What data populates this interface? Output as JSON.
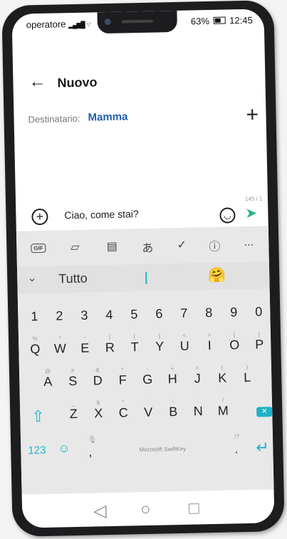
{
  "status": {
    "carrier": "operatore",
    "signal_icon": "signal-icon",
    "battery_percent": "63%",
    "time": "12:45"
  },
  "header": {
    "back_icon": "back-arrow-icon",
    "title": "Nuovo"
  },
  "recipient": {
    "label": "Destinatario:",
    "name": "Mamma",
    "add_icon": "plus-icon"
  },
  "compose": {
    "attach_icon": "plus-circle-icon",
    "message": "Ciao, come stai?",
    "emoji_icon": "smiley-icon",
    "counter": "145 / 1",
    "send_icon": "send-icon"
  },
  "keyboard": {
    "toolbar": {
      "gif": "GIF",
      "items": [
        "sticker-icon",
        "clipboard-icon",
        "translate-icon",
        "check-icon",
        "info-icon",
        "more-icon"
      ],
      "more": "..."
    },
    "suggestion": {
      "word": "Tutto",
      "emoji": "🤗"
    },
    "num_row": [
      {
        "pri": "1",
        "sec": ""
      },
      {
        "pri": "2",
        "sec": ""
      },
      {
        "pri": "3",
        "sec": ""
      },
      {
        "pri": "4",
        "sec": ""
      },
      {
        "pri": "5",
        "sec": ""
      },
      {
        "pri": "6",
        "sec": ""
      },
      {
        "pri": "7",
        "sec": ""
      },
      {
        "pri": "8",
        "sec": ""
      },
      {
        "pri": "9",
        "sec": ""
      },
      {
        "pri": "0",
        "sec": ""
      }
    ],
    "row1": [
      {
        "pri": "Q",
        "sec": "%"
      },
      {
        "pri": "W",
        "sec": "^"
      },
      {
        "pri": "E",
        "sec": "~"
      },
      {
        "pri": "R",
        "sec": "|"
      },
      {
        "pri": "T",
        "sec": "["
      },
      {
        "pri": "Y",
        "sec": "]"
      },
      {
        "pri": "U",
        "sec": "<"
      },
      {
        "pri": "I",
        "sec": ">"
      },
      {
        "pri": "O",
        "sec": "{"
      },
      {
        "pri": "P",
        "sec": "}"
      }
    ],
    "row2": [
      {
        "pri": "A",
        "sec": "@"
      },
      {
        "pri": "S",
        "sec": "#"
      },
      {
        "pri": "D",
        "sec": "&"
      },
      {
        "pri": "F",
        "sec": "*"
      },
      {
        "pri": "G",
        "sec": "-"
      },
      {
        "pri": "H",
        "sec": "+"
      },
      {
        "pri": "J",
        "sec": "="
      },
      {
        "pri": "K",
        "sec": "("
      },
      {
        "pri": "L",
        "sec": ")"
      }
    ],
    "row3": [
      {
        "pri": "Z",
        "sec": "_"
      },
      {
        "pri": "X",
        "sec": "$"
      },
      {
        "pri": "C",
        "sec": "\""
      },
      {
        "pri": "V",
        "sec": "'"
      },
      {
        "pri": "B",
        "sec": ":"
      },
      {
        "pri": "N",
        "sec": ";"
      },
      {
        "pri": "M",
        "sec": "/"
      }
    ],
    "shift_icon": "shift-icon",
    "delete_icon": "backspace-icon",
    "bottom": {
      "num_key": "123",
      "emoji_icon": "smiley-icon",
      "comma": ",",
      "space_label": "Microsoft SwiftKey",
      "period": ".",
      "period_sec": ",!?",
      "enter_icon": "enter-icon"
    }
  },
  "navbar": {
    "back": "◁",
    "home": "○",
    "recents": "□"
  },
  "colors": {
    "accent": "#1cb3c8",
    "recipient": "#1f5fae",
    "send": "#27b48c"
  }
}
